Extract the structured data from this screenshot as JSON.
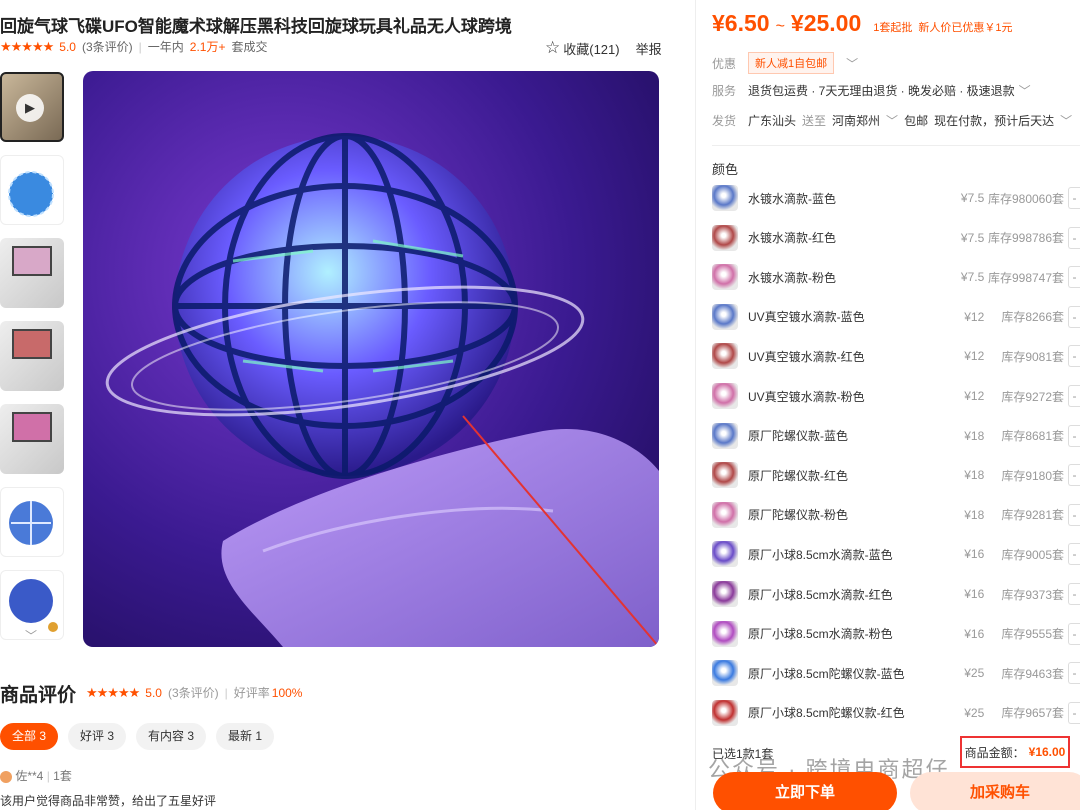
{
  "product": {
    "title": "回旋气球飞碟UFO智能魔术球解压黑科技回旋球玩具礼品无人球跨境",
    "rating_stars": "★★★★★",
    "rating": "5.0",
    "review_count": "(3条评价)",
    "period": "一年内",
    "sold": "2.1万+",
    "sold_unit": "套成交",
    "fav_label": "收藏(121)",
    "report_label": "举报"
  },
  "price": {
    "low": "¥6.50",
    "tilde": "~",
    "high": "¥25.00",
    "min_order": "1套起批",
    "new_user": "新人价已优惠￥1元"
  },
  "service": {
    "promo_key": "优惠",
    "promo_tag": "新人减1自包邮",
    "service_key": "服务",
    "service_val": "退货包运费 · 7天无理由退货 · 晚发必赔 · 极速退款",
    "ship_key": "发货",
    "ship_from": "广东汕头",
    "ship_to_label": "送至",
    "ship_to": "河南郑州",
    "ship_free": "包邮",
    "ship_note": "现在付款，预计后天达"
  },
  "color_heading": "颜色",
  "skus": [
    {
      "name": "水镀水滴款-蓝色",
      "price": "¥7.5",
      "stock": "库存980060套",
      "color": "#5a78c8"
    },
    {
      "name": "水镀水滴款-红色",
      "price": "¥7.5",
      "stock": "库存998786套",
      "color": "#b04848"
    },
    {
      "name": "水镀水滴款-粉色",
      "price": "¥7.5",
      "stock": "库存998747套",
      "color": "#d070a8"
    },
    {
      "name": "UV真空镀水滴款-蓝色",
      "price": "¥12",
      "stock": "库存8266套",
      "color": "#5a78c8"
    },
    {
      "name": "UV真空镀水滴款-红色",
      "price": "¥12",
      "stock": "库存9081套",
      "color": "#b04848"
    },
    {
      "name": "UV真空镀水滴款-粉色",
      "price": "¥12",
      "stock": "库存9272套",
      "color": "#d070a8"
    },
    {
      "name": "原厂陀螺仪款-蓝色",
      "price": "¥18",
      "stock": "库存8681套",
      "color": "#5a78c8"
    },
    {
      "name": "原厂陀螺仪款-红色",
      "price": "¥18",
      "stock": "库存9180套",
      "color": "#b04848"
    },
    {
      "name": "原厂陀螺仪款-粉色",
      "price": "¥18",
      "stock": "库存9281套",
      "color": "#d070a8"
    },
    {
      "name": "原厂小球8.5cm水滴款-蓝色",
      "price": "¥16",
      "stock": "库存9005套",
      "color": "#6a4cc8"
    },
    {
      "name": "原厂小球8.5cm水滴款-红色",
      "price": "¥16",
      "stock": "库存9373套",
      "color": "#8a3a9a"
    },
    {
      "name": "原厂小球8.5cm水滴款-粉色",
      "price": "¥16",
      "stock": "库存9555套",
      "color": "#b04cc0"
    },
    {
      "name": "原厂小球8.5cm陀螺仪款-蓝色",
      "price": "¥25",
      "stock": "库存9463套",
      "color": "#3a7ae0"
    },
    {
      "name": "原厂小球8.5cm陀螺仪款-红色",
      "price": "¥25",
      "stock": "库存9657套",
      "color": "#c03030"
    }
  ],
  "stepper_minus": "-",
  "summary": {
    "selected": "已选1款1套",
    "amount_label": "商品金额：",
    "amount_value": "¥16.00",
    "buy_label": "立即下单",
    "cart_label": "加采购车"
  },
  "reviews": {
    "title": "商品评价",
    "stars": "★★★★★",
    "rating": "5.0",
    "count": "(3条评价)",
    "good_rate_label": "好评率",
    "good_rate": "100%",
    "chips": [
      "全部 3",
      "好评 3",
      "有内容 3",
      "最新 1"
    ],
    "reviewer": "佐**4",
    "reviewer_qty": "1套",
    "text": "该用户觉得商品非常赞，给出了五星好评"
  },
  "watermark": "公众号 · 跨境电商超仔",
  "colors": {
    "accent": "#ff5000",
    "highlight": "#e33333"
  }
}
